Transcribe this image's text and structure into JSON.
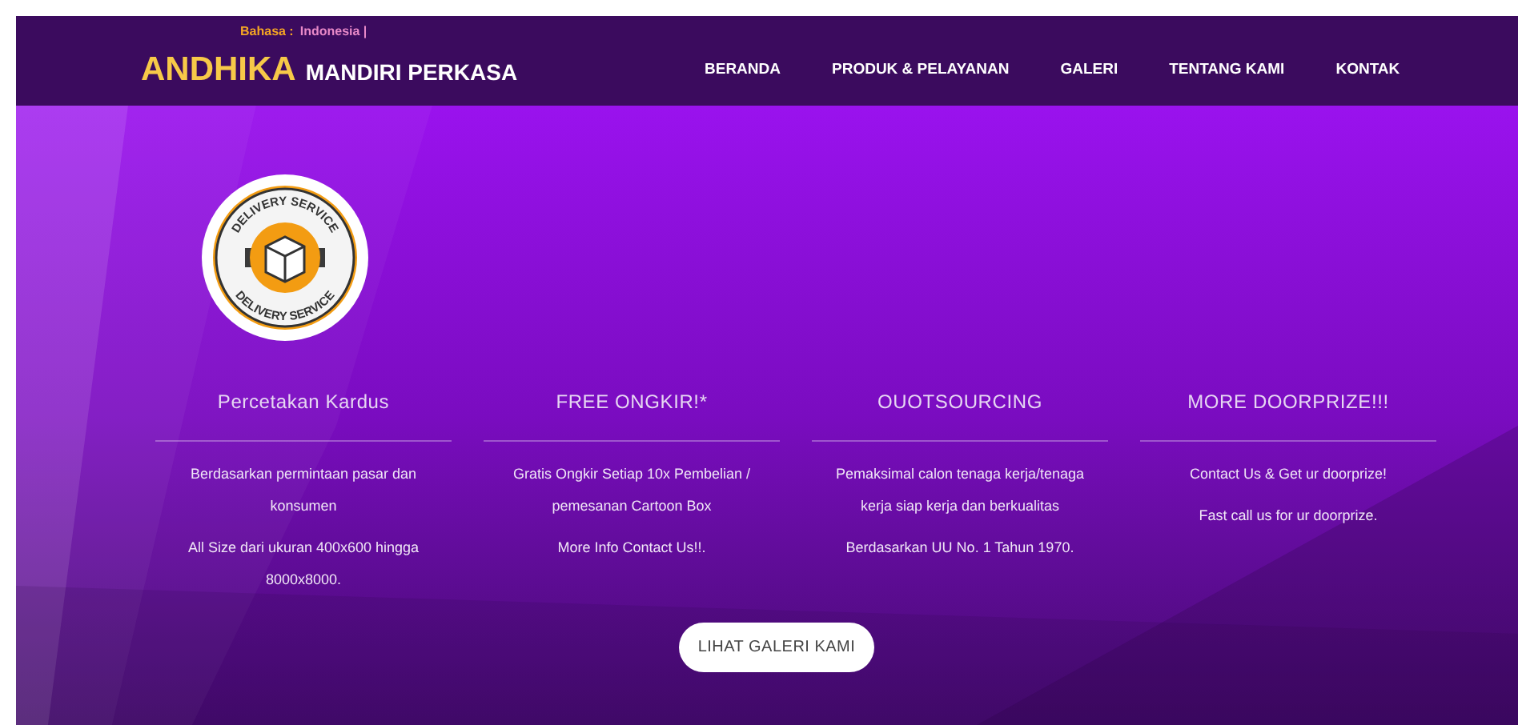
{
  "header": {
    "language_label": "Bahasa :",
    "language_value": "Indonesia |",
    "logo_main": "ANDHIKA",
    "logo_rest": "MANDIRI PERKASA",
    "nav": [
      {
        "label": "BERANDA"
      },
      {
        "label": "PRODUK & PELAYANAN"
      },
      {
        "label": "GALERI"
      },
      {
        "label": "TENTANG KAMI"
      },
      {
        "label": "KONTAK"
      }
    ]
  },
  "hero": {
    "badge": {
      "top_text": "DELIVERY SERVICE",
      "bottom_text": "DELIVERY SERVICE"
    },
    "features": [
      {
        "title": "Percetakan Kardus",
        "paragraphs": [
          "Berdasarkan permintaan pasar dan konsumen",
          "All Size dari ukuran 400x600 hingga 8000x8000."
        ]
      },
      {
        "title": "FREE ONGKIR!*",
        "paragraphs": [
          "Gratis Ongkir Setiap 10x Pembelian / pemesanan Cartoon Box",
          "More Info Contact Us!!."
        ]
      },
      {
        "title": "OUOTSOURCING",
        "paragraphs": [
          "Pemaksimal calon tenaga kerja/tenaga kerja siap kerja dan berkualitas",
          "Berdasarkan UU No. 1 Tahun 1970."
        ]
      },
      {
        "title": "MORE DOORPRIZE!!!",
        "paragraphs": [
          "Contact Us & Get ur doorprize!",
          "Fast call us for ur doorprize."
        ]
      }
    ],
    "button": "LIHAT GALERI KAMI"
  }
}
